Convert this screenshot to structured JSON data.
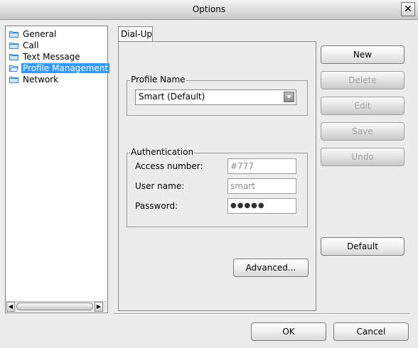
{
  "window": {
    "title": "Options",
    "close_symbol": "✕"
  },
  "tree": {
    "items": [
      {
        "label": "General",
        "selected": false
      },
      {
        "label": "Call",
        "selected": false
      },
      {
        "label": "Text Message",
        "selected": false
      },
      {
        "label": "Profile Management",
        "selected": true
      },
      {
        "label": "Network",
        "selected": false
      }
    ],
    "scroll_left": "◀",
    "scroll_right": "▶"
  },
  "tabs": [
    {
      "label": "Dial-Up"
    }
  ],
  "profile": {
    "group_label": "Profile Name",
    "selected_value": "Smart (Default)"
  },
  "auth": {
    "group_label": "Authentication",
    "access_label": "Access number:",
    "access_value": "#777",
    "user_label": "User name:",
    "user_value": "smart",
    "password_label": "Password:",
    "password_value": "●●●●●"
  },
  "buttons": {
    "advanced": "Advanced...",
    "new": "New",
    "delete": "Delete",
    "edit": "Edit",
    "save": "Save",
    "undo": "Undo",
    "default": "Default",
    "ok": "OK",
    "cancel": "Cancel"
  },
  "colors": {
    "selection": "#3399ff",
    "folder": "#5aa6e8"
  }
}
